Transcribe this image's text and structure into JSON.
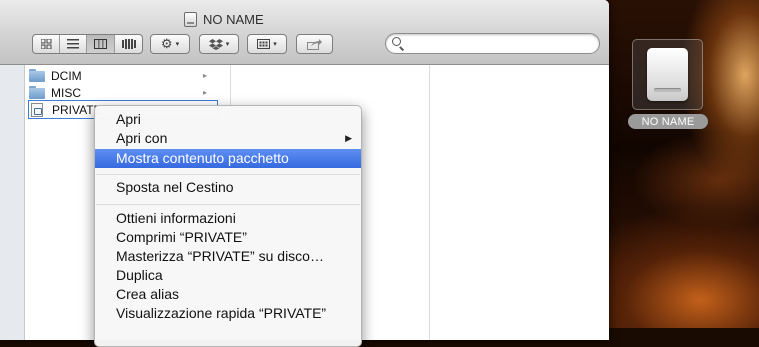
{
  "window": {
    "title": "NO NAME"
  },
  "toolbar": {
    "view_buttons": [
      "icon-view",
      "list-view",
      "column-view",
      "coverflow-view"
    ],
    "action_icon": "gear-icon",
    "dropbox_icon": "dropbox-icon",
    "arrange_icon": "arrange-icon",
    "share_icon": "share-icon"
  },
  "search": {
    "placeholder": "",
    "value": ""
  },
  "column1": {
    "items": [
      {
        "label": "DCIM",
        "type": "folder",
        "has_children": true
      },
      {
        "label": "MISC",
        "type": "folder",
        "has_children": true
      },
      {
        "label": "PRIVATE",
        "type": "package",
        "selected": true
      }
    ]
  },
  "context_menu": {
    "items": [
      {
        "label": "Apri"
      },
      {
        "label": "Apri con",
        "submenu": true
      },
      {
        "label": "Mostra contenuto pacchetto",
        "highlighted": true
      },
      {
        "label": "Sposta nel Cestino"
      },
      {
        "label": "Ottieni informazioni"
      },
      {
        "label": "Comprimi “PRIVATE”"
      },
      {
        "label": "Masterizza “PRIVATE” su disco…"
      },
      {
        "label": "Duplica"
      },
      {
        "label": "Crea alias"
      },
      {
        "label": "Visualizzazione rapida “PRIVATE”"
      }
    ],
    "submenu_arrow": "▶"
  },
  "desktop": {
    "drive_label": "NO NAME"
  },
  "glyphs": {
    "chevron": "▸",
    "caret": "▾"
  }
}
